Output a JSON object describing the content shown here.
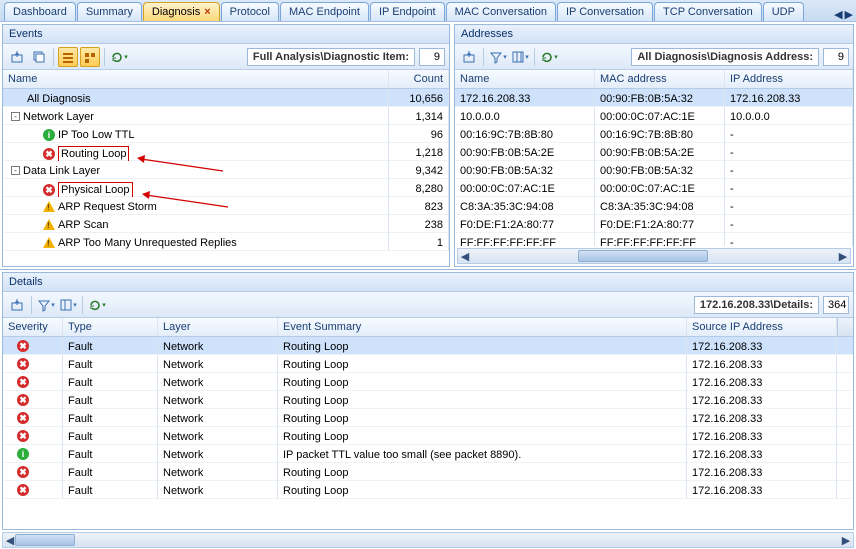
{
  "tabs": [
    {
      "label": "Dashboard",
      "active": false
    },
    {
      "label": "Summary",
      "active": false
    },
    {
      "label": "Diagnosis",
      "active": true
    },
    {
      "label": "Protocol",
      "active": false
    },
    {
      "label": "MAC Endpoint",
      "active": false
    },
    {
      "label": "IP Endpoint",
      "active": false
    },
    {
      "label": "MAC Conversation",
      "active": false
    },
    {
      "label": "IP Conversation",
      "active": false
    },
    {
      "label": "TCP Conversation",
      "active": false
    },
    {
      "label": "UDP",
      "active": false
    }
  ],
  "events_panel": {
    "title": "Events",
    "path_label": "Full Analysis\\Diagnostic Item:",
    "path_count": "9",
    "headers": {
      "name": "Name",
      "count": "Count"
    },
    "rows": [
      {
        "indent": 1,
        "expander": "",
        "icon": "",
        "label": "All Diagnosis",
        "count": "10,656",
        "selected": true
      },
      {
        "indent": 0,
        "expander": "-",
        "icon": "",
        "label": "Network Layer",
        "count": "1,314"
      },
      {
        "indent": 2,
        "expander": "",
        "icon": "info",
        "label": "IP Too Low TTL",
        "count": "96"
      },
      {
        "indent": 2,
        "expander": "",
        "icon": "error",
        "label": "Routing Loop",
        "count": "1,218",
        "redbox": true
      },
      {
        "indent": 0,
        "expander": "-",
        "icon": "",
        "label": "Data Link Layer",
        "count": "9,342"
      },
      {
        "indent": 2,
        "expander": "",
        "icon": "error",
        "label": "Physical Loop",
        "count": "8,280",
        "redbox": true
      },
      {
        "indent": 2,
        "expander": "",
        "icon": "warn",
        "label": "ARP Request Storm",
        "count": "823"
      },
      {
        "indent": 2,
        "expander": "",
        "icon": "warn",
        "label": "ARP Scan",
        "count": "238"
      },
      {
        "indent": 2,
        "expander": "",
        "icon": "warn",
        "label": "ARP Too Many Unrequested Replies",
        "count": "1"
      }
    ]
  },
  "addresses_panel": {
    "title": "Addresses",
    "path_label": "All Diagnosis\\Diagnosis Address:",
    "path_count": "9",
    "headers": {
      "name": "Name",
      "mac": "MAC address",
      "ip": "IP Address"
    },
    "rows": [
      {
        "name": "172.16.208.33",
        "mac": "00:90:FB:0B:5A:32",
        "ip": "172.16.208.33",
        "selected": true
      },
      {
        "name": "10.0.0.0",
        "mac": "00:00:0C:07:AC:1E",
        "ip": "10.0.0.0"
      },
      {
        "name": "00:16:9C:7B:8B:80",
        "mac": "00:16:9C:7B:8B:80",
        "ip": "-"
      },
      {
        "name": "00:90:FB:0B:5A:2E",
        "mac": "00:90:FB:0B:5A:2E",
        "ip": "-"
      },
      {
        "name": "00:90:FB:0B:5A:32",
        "mac": "00:90:FB:0B:5A:32",
        "ip": "-"
      },
      {
        "name": "00:00:0C:07:AC:1E",
        "mac": "00:00:0C:07:AC:1E",
        "ip": "-"
      },
      {
        "name": "C8:3A:35:3C:94:08",
        "mac": "C8:3A:35:3C:94:08",
        "ip": "-"
      },
      {
        "name": "F0:DE:F1:2A:80:77",
        "mac": "F0:DE:F1:2A:80:77",
        "ip": "-"
      },
      {
        "name": "FF:FF:FF:FF:FF:FF",
        "mac": "FF:FF:FF:FF:FF:FF",
        "ip": "-"
      }
    ]
  },
  "details_panel": {
    "title": "Details",
    "path_label": "172.16.208.33\\Details:",
    "path_count": "364",
    "headers": {
      "sev": "Severity",
      "type": "Type",
      "layer": "Layer",
      "sum": "Event Summary",
      "src": "Source IP Address"
    },
    "rows": [
      {
        "icon": "error",
        "type": "Fault",
        "layer": "Network",
        "sum": "Routing Loop",
        "src": "172.16.208.33",
        "selected": true
      },
      {
        "icon": "error",
        "type": "Fault",
        "layer": "Network",
        "sum": "Routing Loop",
        "src": "172.16.208.33"
      },
      {
        "icon": "error",
        "type": "Fault",
        "layer": "Network",
        "sum": "Routing Loop",
        "src": "172.16.208.33"
      },
      {
        "icon": "error",
        "type": "Fault",
        "layer": "Network",
        "sum": "Routing Loop",
        "src": "172.16.208.33"
      },
      {
        "icon": "error",
        "type": "Fault",
        "layer": "Network",
        "sum": "Routing Loop",
        "src": "172.16.208.33"
      },
      {
        "icon": "error",
        "type": "Fault",
        "layer": "Network",
        "sum": "Routing Loop",
        "src": "172.16.208.33"
      },
      {
        "icon": "info",
        "type": "Fault",
        "layer": "Network",
        "sum": "IP packet TTL value too small (see packet 8890).",
        "src": "172.16.208.33"
      },
      {
        "icon": "error",
        "type": "Fault",
        "layer": "Network",
        "sum": "Routing Loop",
        "src": "172.16.208.33"
      },
      {
        "icon": "error",
        "type": "Fault",
        "layer": "Network",
        "sum": "Routing Loop",
        "src": "172.16.208.33"
      }
    ]
  }
}
